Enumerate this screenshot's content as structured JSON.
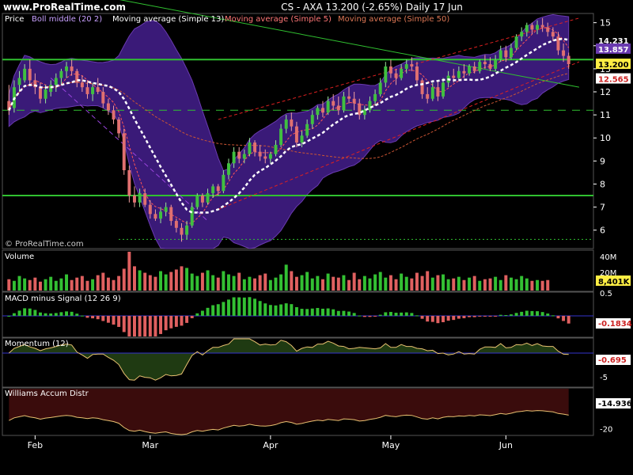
{
  "header": {
    "site": "www.ProRealTime.com",
    "title": "CS - AXA    13.200 (-2.65%)    Daily  17 Jun"
  },
  "watermark": "© ProRealTime.com",
  "colors": {
    "background": "#000000",
    "band_fill": "#3a1a78",
    "band_edge": "#6a3ab0",
    "up_candle": "#40c040",
    "down_candle": "#e07070",
    "ma13": "#ffffff",
    "ma5": "#ff5555",
    "ma50": "#cc5533",
    "trend_green": "#30c030",
    "channel_red": "#dd2020",
    "axis_text": "#ffffff",
    "volume_up": "#33c033",
    "volume_down": "#e06060",
    "macd_up": "#33c033",
    "macd_down": "#e06060",
    "momentum_fill": "#1f3a12",
    "momentum_line": "#e8c070",
    "williams_fill": "#3a0c0c",
    "williams_line": "#e8c070",
    "zero_line": "#3333cc"
  },
  "chart_data": [
    {
      "type": "candlestick",
      "panel": "price",
      "legend": [
        "Price",
        "Boll middle (20 2)",
        "Moving average (Simple 13)",
        "Moving average (Simple 5)",
        "Moving average (Simple 50)"
      ],
      "x_ticks": [
        "Feb",
        "Mar",
        "Apr",
        "May",
        "Jun"
      ],
      "y_ticks": [
        6,
        7,
        8,
        9,
        10,
        11,
        12,
        13,
        14,
        15
      ],
      "ylim": [
        5.2,
        15.4
      ],
      "ohlc": [
        {
          "o": 11.6,
          "h": 12.3,
          "l": 11.0,
          "c": 11.2
        },
        {
          "o": 11.3,
          "h": 12.5,
          "l": 11.1,
          "c": 12.2
        },
        {
          "o": 12.3,
          "h": 12.9,
          "l": 12.0,
          "c": 12.6
        },
        {
          "o": 12.5,
          "h": 13.2,
          "l": 12.4,
          "c": 13.0
        },
        {
          "o": 13.0,
          "h": 13.4,
          "l": 12.3,
          "c": 12.5
        },
        {
          "o": 12.5,
          "h": 12.8,
          "l": 11.9,
          "c": 12.2
        },
        {
          "o": 12.2,
          "h": 12.4,
          "l": 11.5,
          "c": 11.7
        },
        {
          "o": 11.7,
          "h": 12.3,
          "l": 11.5,
          "c": 12.1
        },
        {
          "o": 12.0,
          "h": 12.5,
          "l": 11.8,
          "c": 12.3
        },
        {
          "o": 12.3,
          "h": 12.8,
          "l": 12.0,
          "c": 12.6
        },
        {
          "o": 12.6,
          "h": 13.0,
          "l": 12.3,
          "c": 12.9
        },
        {
          "o": 12.9,
          "h": 13.3,
          "l": 12.6,
          "c": 13.1
        },
        {
          "o": 13.1,
          "h": 13.4,
          "l": 12.7,
          "c": 12.9
        },
        {
          "o": 12.9,
          "h": 13.0,
          "l": 12.2,
          "c": 12.4
        },
        {
          "o": 12.4,
          "h": 12.7,
          "l": 12.0,
          "c": 12.2
        },
        {
          "o": 12.2,
          "h": 12.5,
          "l": 11.7,
          "c": 11.9
        },
        {
          "o": 11.9,
          "h": 12.4,
          "l": 11.6,
          "c": 12.2
        },
        {
          "o": 12.2,
          "h": 12.6,
          "l": 11.9,
          "c": 12.0
        },
        {
          "o": 12.0,
          "h": 12.2,
          "l": 11.3,
          "c": 11.5
        },
        {
          "o": 11.5,
          "h": 11.7,
          "l": 11.0,
          "c": 11.2
        },
        {
          "o": 11.2,
          "h": 11.4,
          "l": 10.6,
          "c": 10.8
        },
        {
          "o": 10.8,
          "h": 10.9,
          "l": 10.0,
          "c": 10.2
        },
        {
          "o": 10.2,
          "h": 10.4,
          "l": 8.4,
          "c": 8.6
        },
        {
          "o": 8.6,
          "h": 8.8,
          "l": 7.2,
          "c": 7.5
        },
        {
          "o": 7.5,
          "h": 7.9,
          "l": 7.0,
          "c": 7.2
        },
        {
          "o": 7.2,
          "h": 7.8,
          "l": 7.0,
          "c": 7.6
        },
        {
          "o": 7.6,
          "h": 7.8,
          "l": 7.0,
          "c": 7.1
        },
        {
          "o": 7.1,
          "h": 7.3,
          "l": 6.5,
          "c": 6.7
        },
        {
          "o": 6.7,
          "h": 6.9,
          "l": 6.4,
          "c": 6.5
        },
        {
          "o": 6.5,
          "h": 7.0,
          "l": 6.3,
          "c": 6.8
        },
        {
          "o": 6.8,
          "h": 7.2,
          "l": 6.6,
          "c": 7.0
        },
        {
          "o": 7.0,
          "h": 7.1,
          "l": 6.2,
          "c": 6.4
        },
        {
          "o": 6.4,
          "h": 6.5,
          "l": 5.9,
          "c": 6.1
        },
        {
          "o": 6.1,
          "h": 6.3,
          "l": 5.5,
          "c": 5.8
        },
        {
          "o": 5.8,
          "h": 6.4,
          "l": 5.6,
          "c": 6.2
        },
        {
          "o": 6.2,
          "h": 7.2,
          "l": 6.1,
          "c": 7.0
        },
        {
          "o": 7.0,
          "h": 7.6,
          "l": 6.9,
          "c": 7.5
        },
        {
          "o": 7.5,
          "h": 7.6,
          "l": 7.0,
          "c": 7.2
        },
        {
          "o": 7.2,
          "h": 7.8,
          "l": 7.1,
          "c": 7.6
        },
        {
          "o": 7.6,
          "h": 8.0,
          "l": 7.4,
          "c": 7.9
        },
        {
          "o": 7.9,
          "h": 8.0,
          "l": 7.5,
          "c": 7.7
        },
        {
          "o": 7.7,
          "h": 8.6,
          "l": 7.6,
          "c": 8.4
        },
        {
          "o": 8.4,
          "h": 9.1,
          "l": 8.2,
          "c": 8.9
        },
        {
          "o": 8.9,
          "h": 9.6,
          "l": 8.7,
          "c": 9.4
        },
        {
          "o": 9.4,
          "h": 9.6,
          "l": 8.9,
          "c": 9.1
        },
        {
          "o": 9.1,
          "h": 9.5,
          "l": 8.9,
          "c": 9.3
        },
        {
          "o": 9.3,
          "h": 10.0,
          "l": 9.2,
          "c": 9.8
        },
        {
          "o": 9.8,
          "h": 9.9,
          "l": 9.2,
          "c": 9.4
        },
        {
          "o": 9.4,
          "h": 9.7,
          "l": 9.0,
          "c": 9.2
        },
        {
          "o": 9.2,
          "h": 9.5,
          "l": 8.9,
          "c": 9.1
        },
        {
          "o": 9.1,
          "h": 9.4,
          "l": 8.9,
          "c": 9.3
        },
        {
          "o": 9.3,
          "h": 9.9,
          "l": 9.2,
          "c": 9.7
        },
        {
          "o": 9.7,
          "h": 10.6,
          "l": 9.6,
          "c": 10.4
        },
        {
          "o": 10.4,
          "h": 11.0,
          "l": 10.2,
          "c": 10.8
        },
        {
          "o": 10.8,
          "h": 11.1,
          "l": 10.3,
          "c": 10.5
        },
        {
          "o": 10.5,
          "h": 10.7,
          "l": 9.6,
          "c": 9.8
        },
        {
          "o": 9.8,
          "h": 10.3,
          "l": 9.6,
          "c": 10.1
        },
        {
          "o": 10.1,
          "h": 10.8,
          "l": 10.0,
          "c": 10.6
        },
        {
          "o": 10.6,
          "h": 11.2,
          "l": 10.4,
          "c": 11.0
        },
        {
          "o": 11.0,
          "h": 11.4,
          "l": 10.8,
          "c": 11.3
        },
        {
          "o": 11.3,
          "h": 11.6,
          "l": 10.9,
          "c": 11.1
        },
        {
          "o": 11.1,
          "h": 11.8,
          "l": 11.0,
          "c": 11.6
        },
        {
          "o": 11.6,
          "h": 11.9,
          "l": 11.2,
          "c": 11.4
        },
        {
          "o": 11.4,
          "h": 11.8,
          "l": 11.0,
          "c": 11.2
        },
        {
          "o": 11.2,
          "h": 12.0,
          "l": 11.1,
          "c": 11.8
        },
        {
          "o": 11.8,
          "h": 12.2,
          "l": 11.5,
          "c": 11.7
        },
        {
          "o": 11.7,
          "h": 12.0,
          "l": 11.2,
          "c": 11.5
        },
        {
          "o": 11.5,
          "h": 11.7,
          "l": 10.8,
          "c": 11.0
        },
        {
          "o": 11.0,
          "h": 11.4,
          "l": 10.8,
          "c": 11.2
        },
        {
          "o": 11.2,
          "h": 11.8,
          "l": 11.1,
          "c": 11.6
        },
        {
          "o": 11.6,
          "h": 12.1,
          "l": 11.4,
          "c": 11.9
        },
        {
          "o": 11.9,
          "h": 12.6,
          "l": 11.8,
          "c": 12.4
        },
        {
          "o": 12.4,
          "h": 13.3,
          "l": 12.2,
          "c": 13.1
        },
        {
          "o": 13.1,
          "h": 13.4,
          "l": 12.6,
          "c": 12.8
        },
        {
          "o": 12.8,
          "h": 13.0,
          "l": 12.3,
          "c": 12.6
        },
        {
          "o": 12.6,
          "h": 13.2,
          "l": 12.5,
          "c": 13.0
        },
        {
          "o": 13.0,
          "h": 13.4,
          "l": 12.8,
          "c": 13.2
        },
        {
          "o": 13.2,
          "h": 13.5,
          "l": 12.9,
          "c": 13.1
        },
        {
          "o": 13.1,
          "h": 13.3,
          "l": 12.3,
          "c": 12.5
        },
        {
          "o": 12.5,
          "h": 12.6,
          "l": 11.7,
          "c": 11.9
        },
        {
          "o": 11.9,
          "h": 12.2,
          "l": 11.5,
          "c": 11.7
        },
        {
          "o": 11.7,
          "h": 12.4,
          "l": 11.6,
          "c": 12.2
        },
        {
          "o": 12.2,
          "h": 12.5,
          "l": 11.6,
          "c": 11.8
        },
        {
          "o": 11.8,
          "h": 12.6,
          "l": 11.7,
          "c": 12.4
        },
        {
          "o": 12.4,
          "h": 12.9,
          "l": 12.2,
          "c": 12.7
        },
        {
          "o": 12.7,
          "h": 13.0,
          "l": 12.4,
          "c": 12.6
        },
        {
          "o": 12.6,
          "h": 13.1,
          "l": 12.5,
          "c": 12.9
        },
        {
          "o": 12.9,
          "h": 13.2,
          "l": 12.6,
          "c": 12.8
        },
        {
          "o": 12.8,
          "h": 13.2,
          "l": 12.7,
          "c": 13.1
        },
        {
          "o": 13.1,
          "h": 13.3,
          "l": 12.8,
          "c": 12.9
        },
        {
          "o": 12.9,
          "h": 13.4,
          "l": 12.8,
          "c": 13.3
        },
        {
          "o": 13.3,
          "h": 13.6,
          "l": 13.0,
          "c": 13.2
        },
        {
          "o": 13.2,
          "h": 13.5,
          "l": 12.9,
          "c": 13.0
        },
        {
          "o": 13.0,
          "h": 13.6,
          "l": 12.9,
          "c": 13.4
        },
        {
          "o": 13.4,
          "h": 14.0,
          "l": 13.3,
          "c": 13.8
        },
        {
          "o": 13.8,
          "h": 14.0,
          "l": 13.3,
          "c": 13.5
        },
        {
          "o": 13.5,
          "h": 14.1,
          "l": 13.4,
          "c": 13.9
        },
        {
          "o": 13.9,
          "h": 14.5,
          "l": 13.8,
          "c": 14.4
        },
        {
          "o": 14.4,
          "h": 14.8,
          "l": 14.2,
          "c": 14.6
        },
        {
          "o": 14.6,
          "h": 15.0,
          "l": 14.4,
          "c": 14.9
        },
        {
          "o": 14.9,
          "h": 15.0,
          "l": 14.5,
          "c": 14.7
        },
        {
          "o": 14.7,
          "h": 15.1,
          "l": 14.5,
          "c": 14.9
        },
        {
          "o": 14.9,
          "h": 15.2,
          "l": 14.6,
          "c": 14.8
        },
        {
          "o": 14.8,
          "h": 15.0,
          "l": 14.4,
          "c": 14.6
        },
        {
          "o": 14.6,
          "h": 14.8,
          "l": 14.2,
          "c": 14.4
        },
        {
          "o": 14.4,
          "h": 14.6,
          "l": 13.6,
          "c": 13.8
        },
        {
          "o": 13.8,
          "h": 14.1,
          "l": 13.3,
          "c": 13.56
        },
        {
          "o": 13.56,
          "h": 13.7,
          "l": 13.0,
          "c": 13.2
        }
      ],
      "series_labels": {
        "ma13": "14.231",
        "boll_mid": "13.857",
        "ma5": "12.565",
        "last": "13.200"
      },
      "levels": {
        "support_green_1": 13.4,
        "support_green_2": 7.5,
        "dashed_green": 11.2,
        "dotted_green": 5.6
      }
    },
    {
      "type": "bar",
      "panel": "volume",
      "title": "Volume",
      "y_ticks": [
        "40M",
        "20M"
      ],
      "last_label": "8,401K",
      "values": [
        14,
        12,
        18,
        15,
        13,
        16,
        11,
        14,
        17,
        12,
        15,
        20,
        13,
        16,
        18,
        12,
        14,
        19,
        22,
        16,
        13,
        18,
        27,
        48,
        30,
        25,
        22,
        19,
        17,
        24,
        20,
        23,
        26,
        30,
        28,
        21,
        18,
        22,
        25,
        19,
        16,
        24,
        20,
        18,
        22,
        14,
        17,
        15,
        19,
        21,
        13,
        16,
        20,
        32,
        24,
        17,
        19,
        23,
        15,
        18,
        14,
        21,
        17,
        16,
        19,
        13,
        22,
        14,
        18,
        15,
        20,
        23,
        16,
        19,
        14,
        21,
        17,
        15,
        22,
        18,
        24,
        16,
        19,
        20,
        14,
        15,
        17,
        13,
        16,
        18,
        12,
        14,
        15,
        17,
        13,
        19,
        16,
        14,
        18,
        15,
        12,
        13,
        12,
        13
      ]
    },
    {
      "type": "bar",
      "panel": "macd",
      "title": "MACD minus Signal (12 26 9)",
      "y_ticks": [
        "0.5"
      ],
      "last_label": "-0.1834",
      "ylim": [
        -0.45,
        0.5
      ]
    },
    {
      "type": "area",
      "panel": "momentum",
      "title": "Momentum (12)",
      "y_ticks": [
        "-5"
      ],
      "last_label": "-0.695",
      "ylim": [
        -7,
        3
      ]
    },
    {
      "type": "area",
      "panel": "williams",
      "title": "Williams Accum Distr",
      "y_ticks": [
        "-20"
      ],
      "last_label": "-14.936",
      "ylim": [
        -23,
        0
      ]
    }
  ]
}
